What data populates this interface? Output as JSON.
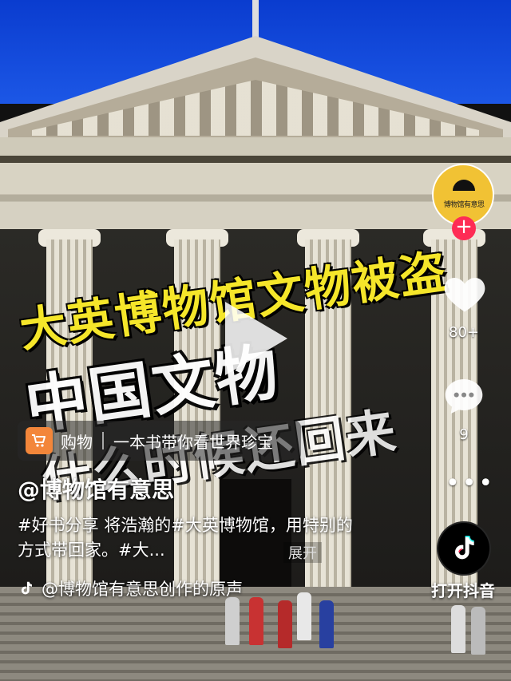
{
  "video": {
    "headline_line1": "大英博物馆文物被盗",
    "headline_line2": "中国文物",
    "headline_line3": "什么时候还回来"
  },
  "rail": {
    "avatar_text": "博物馆有意思",
    "follow_symbol": "+",
    "like_count": "80+",
    "comment_count": "9",
    "more_symbol": "•••",
    "open_app_label": "打开抖音"
  },
  "shop": {
    "label": "购物",
    "title": "一本书带你看世界珍宝"
  },
  "caption": {
    "author": "@博物馆有意思",
    "description": "#好书分享 将浩瀚的#大英博物馆，用特别的方式带回家。#大...",
    "expand_label": "展开",
    "music": "@博物馆有意思创作的原声"
  },
  "colors": {
    "headline_yellow": "#f5e62a",
    "follow_red": "#fe2c55",
    "cart_orange": "#f3863a",
    "avatar_yellow": "#f1c234"
  },
  "icons": [
    "heart-icon",
    "comment-bubble-icon",
    "more-icon",
    "tiktok-logo-icon",
    "cart-icon",
    "music-note-icon",
    "play-icon"
  ]
}
